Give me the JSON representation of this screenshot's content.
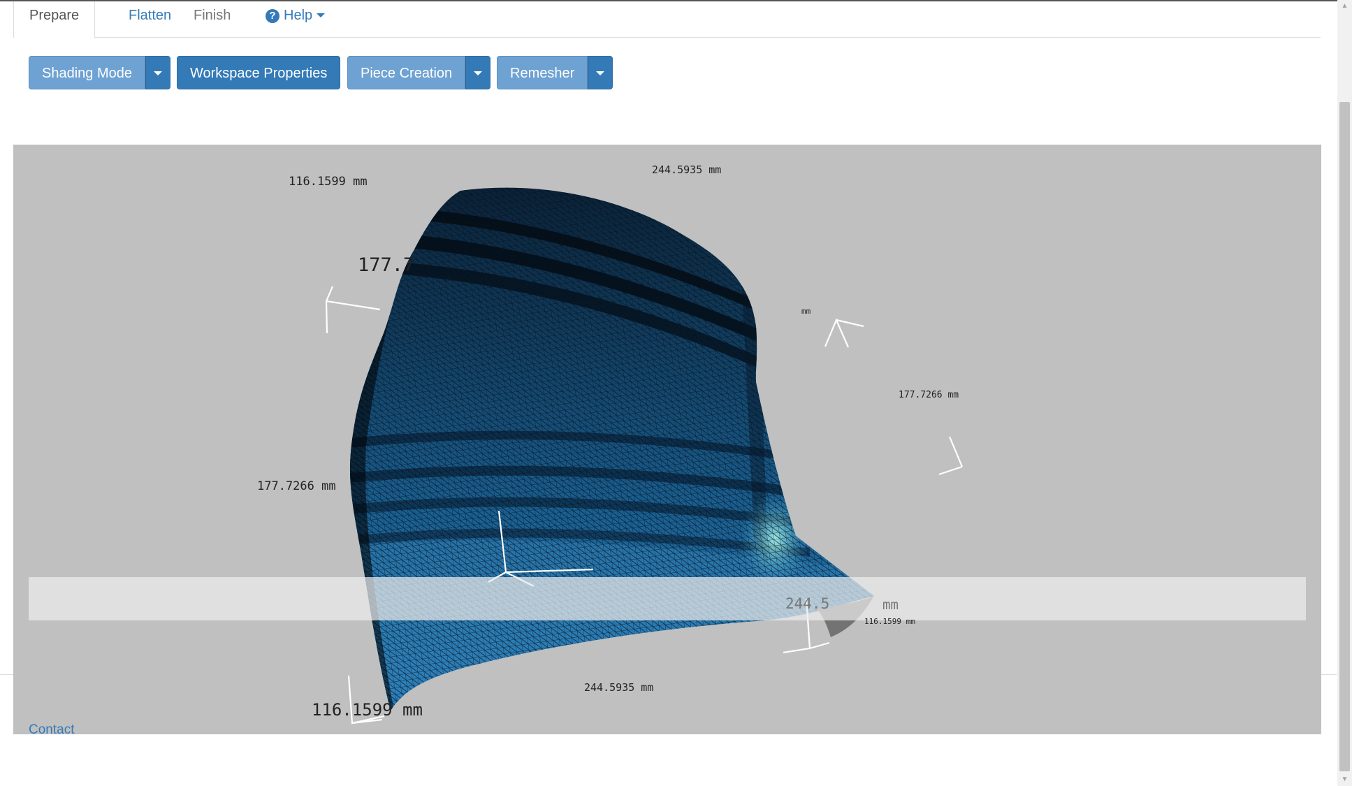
{
  "tabs": [
    {
      "label": "Prepare"
    },
    {
      "label": "Flatten"
    },
    {
      "label": "Finish"
    },
    {
      "label": "Help",
      "icon": "question-circle-icon"
    }
  ],
  "toolbar": {
    "shading_mode": "Shading Mode",
    "workspace_properties": "Workspace Properties",
    "piece_creation": "Piece Creation",
    "remesher": "Remesher"
  },
  "viewport": {
    "dimensions": {
      "d1": "116.1599 mm",
      "d2": "244.5935 mm",
      "d3": "177.7",
      "d4": "mm",
      "d5": "177.7266 mm",
      "d6": "177.7266 mm",
      "d7": "244.5",
      "d8": "mm",
      "d9": "116.1599 mm",
      "d10": "244.5935 mm",
      "d11": "116.1599 mm"
    },
    "colors": {
      "background": "#c0c0c0",
      "mesh_dark": "#0b2a44",
      "mesh_mid": "#1f6fa6",
      "mesh_highlight": "#7fe0d6"
    }
  },
  "footer": {
    "contact": "Contact"
  }
}
